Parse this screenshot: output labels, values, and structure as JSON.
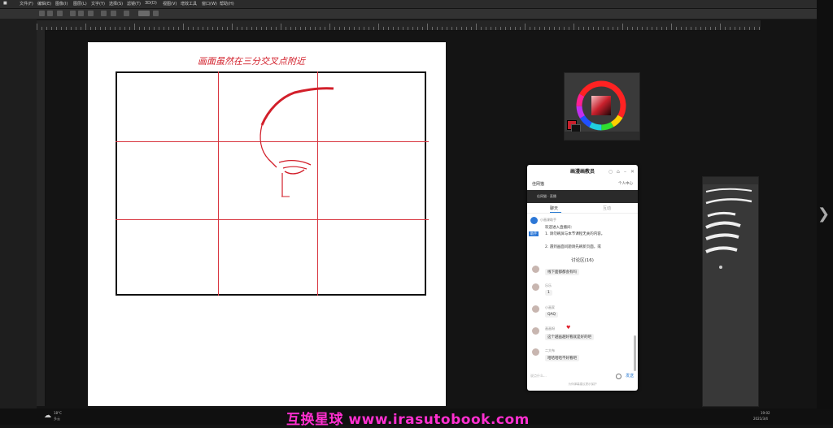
{
  "menu": {
    "items": [
      "文件(F)",
      "编辑(E)",
      "图像(I)",
      "图层(L)",
      "文字(Y)",
      "选择(S)",
      "滤镜(T)",
      "3D(D)",
      "视图(V)",
      "增效工具",
      "窗口(W)",
      "帮助(H)"
    ]
  },
  "canvas": {
    "note": "画面虽然在三分交叉点附近"
  },
  "colors": {
    "accent": "#d8343e",
    "foreground": "#c8202c",
    "background": "#111111",
    "watermark": "#ff2fd0"
  },
  "chat": {
    "title": "画漫画教员",
    "host": "佳网猫",
    "follow": "个人中心",
    "video_label": "佳网猫 · 直播",
    "tabs": [
      "聊天",
      "互动"
    ],
    "notice_label": "小画课助手",
    "notice_badge": "助手",
    "notice_lines": [
      "欢迎进入直播间：",
      "1. 请勿刷屏与本节课程无关的内容。",
      "2. 遇到画面问题请先刷新页面，或"
    ],
    "section": "讨论区(16)",
    "messages": [
      {
        "name": "",
        "text": "线下面都都会有吗"
      },
      {
        "name": "乐乐",
        "text": "1"
      },
      {
        "name": "小画家",
        "text": "QAQ"
      },
      {
        "name": "画画呀",
        "text": "这个越画越好看就是好的吧"
      },
      {
        "name": "二大布",
        "text": "哈哈哈哈不好看吧"
      }
    ],
    "input_placeholder": "说点什么...",
    "send": "发送",
    "footer": "为你弹幕建议提示保护"
  },
  "taskbar": {
    "weather_temp": "18°C",
    "weather_text": "多云",
    "time": "19:02",
    "date": "2021/3/4"
  },
  "watermark": "互换星球 www.irasutobook.com",
  "icons": {
    "next": "chevron-right-icon",
    "search": "search-icon",
    "close": "close-icon",
    "minimize": "minimize-icon"
  }
}
